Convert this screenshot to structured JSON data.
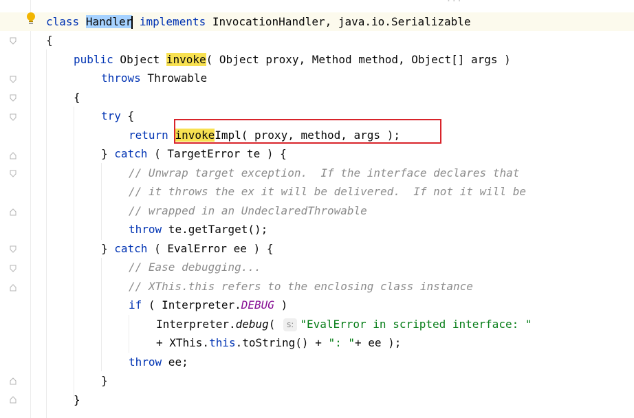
{
  "editor": {
    "language": "java",
    "colors": {
      "keyword": "#0033b3",
      "comment": "#8c8c8c",
      "string": "#067d17",
      "constant": "#871094",
      "usage_highlight": "#f8e151",
      "selection": "#a6d2ff",
      "annotation_box": "#d8232a"
    },
    "top_strip_text": "...",
    "param_hint": "s:",
    "tokens": {
      "class": "class",
      "Handler": "Handler",
      "implements": "implements",
      "interfaces": " InvocationHandler, java.io.Serializable",
      "open_brace": "{",
      "close_brace": "}",
      "public": "public",
      "Object": " Object ",
      "invoke": "invoke",
      "invoke_params": "( Object proxy, Method method, Object[] args )",
      "throws": "throws",
      "Throwable": " Throwable",
      "try": "try",
      "try_rest": " {",
      "return": "return",
      "space": " ",
      "invoke2": "invoke",
      "impl_rest": "Impl( proxy, method, args );",
      "close_catch_prefix": "} ",
      "catch": "catch",
      "catch1_rest": " ( TargetError te ) {",
      "comment1": "// Unwrap target exception.  If the interface declares that",
      "comment2": "// it throws the ex it will be delivered.  If not it will be",
      "comment3": "// wrapped in an UndeclaredThrowable",
      "throw": "throw",
      "throw1_rest": " te.getTarget();",
      "catch2_rest": " ( EvalError ee ) {",
      "comment4": "// Ease debugging...",
      "comment5": "// XThis.this refers to the enclosing class instance",
      "if": "if",
      "if_open": " ( Interpreter.",
      "DEBUG": "DEBUG",
      "if_close": " )",
      "interp_prefix": "Interpreter.",
      "debug": "debug",
      "debug_paren": "( ",
      "str1": "\"EvalError in scripted interface: \"",
      "concat_prefix": "+ XThis.",
      "this": "this",
      "concat_mid": ".toString() + ",
      "str2": "\": \"",
      "concat_end": "+ ee );",
      "throw2_rest": " ee;"
    }
  }
}
